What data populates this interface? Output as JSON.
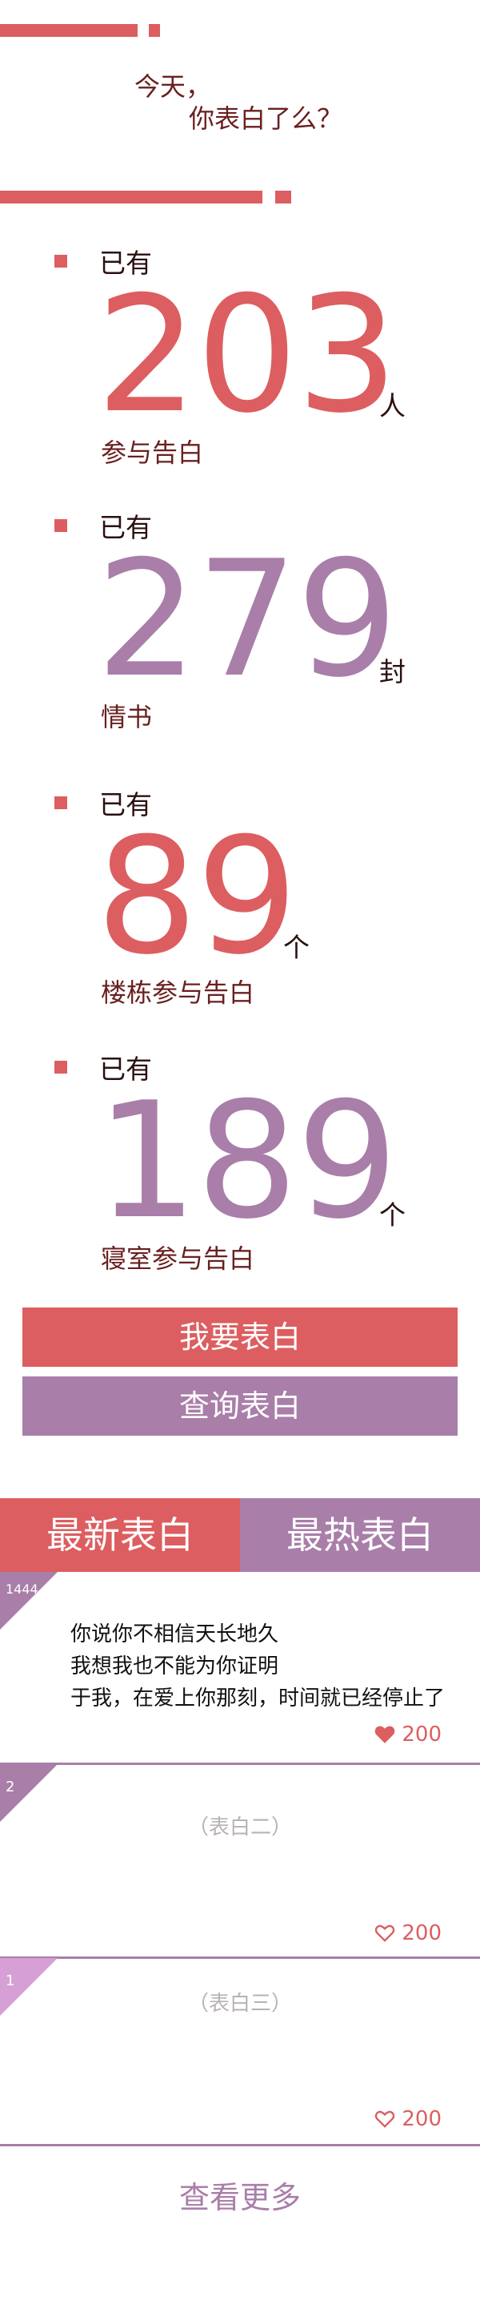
{
  "hero": {
    "line1": "今天，",
    "line2": "你表白了么？"
  },
  "stats": [
    {
      "prefix": "已有",
      "number": "203",
      "unit": "人",
      "label": "参与告白"
    },
    {
      "prefix": "已有",
      "number": "279",
      "unit": "封",
      "label": "情书"
    },
    {
      "prefix": "已有",
      "number": "89",
      "unit": "个",
      "label": "楼栋参与告白"
    },
    {
      "prefix": "已有",
      "number": "189",
      "unit": "个",
      "label": "寝室参与告白"
    }
  ],
  "buttons": {
    "confess": "我要表白",
    "query": "查询表白"
  },
  "tabs": {
    "latest": "最新表白",
    "hottest": "最热表白"
  },
  "cards": [
    {
      "id": "1444",
      "lines": [
        "你说你不相信天长地久",
        "我想我也不能为你证明",
        "于我，在爱上你那刻，时间就已经停止了"
      ],
      "likes": "200"
    },
    {
      "id": "2",
      "placeholder": "（表白二）",
      "likes": "200"
    },
    {
      "id": "1",
      "placeholder": "（表白三）",
      "likes": "200"
    }
  ],
  "more": "查看更多",
  "colors": {
    "red": "#dd5e60",
    "purple": "#a97ea9",
    "lilac": "#d6a0d6"
  }
}
